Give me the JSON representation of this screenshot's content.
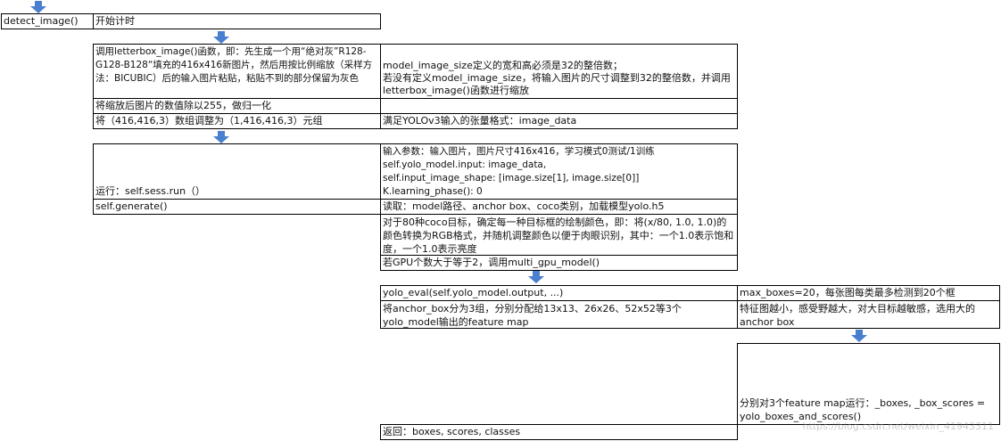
{
  "colors": {
    "arrow": "#4a7fcf",
    "border": "#000000",
    "text": "#111111"
  },
  "icons": {
    "arrow": "down-arrow-icon"
  },
  "row1": {
    "func": "detect_image()",
    "desc": "开始计时"
  },
  "row2": {
    "left": "调用letterbox_image()函数，即：先生成一个用“绝对灰”R128-G128-B128“填充的416x416新图片，然后用按比例缩放（采样方法：BICUBIC）后的输入图片粘贴，粘贴不到的部分保留为灰色",
    "right": "model_image_size定义的宽和高必须是32的整倍数；\n若没有定义model_image_size，将输入图片的尺寸调整到32的整倍数，并调用letterbox_image()函数进行缩放"
  },
  "row3": {
    "text": "将缩放后图片的数值除以255，做归一化"
  },
  "row4": {
    "left": "将（416,416,3）数组调整为（1,416,416,3）元组",
    "right": "满足YOLOv3输入的张量格式：image_data"
  },
  "row5": {
    "left": "运行：self.sess.run（）",
    "right": "输入参数：输入图片，图片尺寸416x416，学习模式0测试/1训练\nself.yolo_model.input: image_data,\nself.input_image_shape: [image.size[1], image.size[0]]\nK.learning_phase(): 0"
  },
  "row6": {
    "left": "self.generate()",
    "right": "读取：model路径、anchor box、coco类别，加载模型yolo.h5"
  },
  "row7": {
    "colors": "对于80种coco目标，确定每一种目标框的绘制颜色，即：将(x/80, 1.0, 1.0)的颜色转换为RGB格式，并随机调整颜色以便于肉眼识别，其中：一个1.0表示饱和度，一个1.0表示亮度",
    "gpu": "若GPU个数大于等于2，调用multi_gpu_model()"
  },
  "row8": {
    "left": "yolo_eval(self.yolo_model.output, ...)",
    "right": "max_boxes=20，每张图每类最多检测到20个框"
  },
  "row9": {
    "left": "将anchor_box分为3组，分别分配给13x13、26x26、52x52等3个yolo_model输出的feature map",
    "right": "特征图越小，感受野越大，对大目标越敏感，选用大的anchor box"
  },
  "row10": {
    "text": "分别对3个feature map运行：_boxes, _box_scores = yolo_boxes_and_scores()"
  },
  "row11": {
    "text": "返回：boxes, scores, classes"
  },
  "watermark": "https://blog.csdn.net/weixin_41943311"
}
